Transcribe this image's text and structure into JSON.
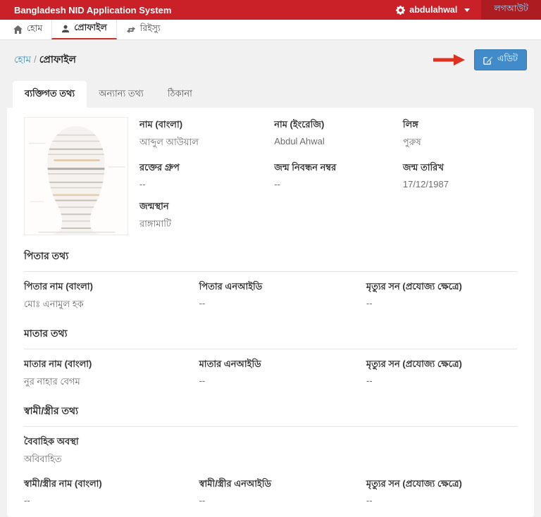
{
  "header": {
    "title": "Bangladesh NID Application System",
    "username": "abdulahwal",
    "logout_label": "লগআউট"
  },
  "nav": {
    "items": [
      {
        "label": "হোম",
        "icon": "home-icon",
        "active": false
      },
      {
        "label": "প্রোফাইল",
        "icon": "user-icon",
        "active": true
      },
      {
        "label": "রিইস্যু",
        "icon": "refresh-icon",
        "active": false
      }
    ]
  },
  "breadcrumb": {
    "home": "হোম",
    "separator": "/",
    "current": "প্রোফাইল"
  },
  "toolbar": {
    "edit_label": "এডিট"
  },
  "tabs": [
    {
      "label": "ব্যক্তিগত তথ্য",
      "active": true
    },
    {
      "label": "অন্যান্য তথ্য",
      "active": false
    },
    {
      "label": "ঠিকানা",
      "active": false
    }
  ],
  "personal": {
    "fields": [
      {
        "label": "নাম (বাংলা)",
        "value": "আব্দুল আউয়াল"
      },
      {
        "label": "নাম (ইংরেজি)",
        "value": "Abdul Ahwal"
      },
      {
        "label": "লিঙ্গ",
        "value": "পুরুষ"
      },
      {
        "label": "রক্তের গ্রুপ",
        "value": "--"
      },
      {
        "label": "জন্ম নিবন্ধন নম্বর",
        "value": "--"
      },
      {
        "label": "জন্ম তারিখ",
        "value": "17/12/1987"
      },
      {
        "label": "জন্মস্থান",
        "value": "রাঙ্গামাটি"
      }
    ]
  },
  "father": {
    "title": "পিতার তথ্য",
    "fields": [
      {
        "label": "পিতার নাম (বাংলা)",
        "value": "মোঃ এনামুল হক"
      },
      {
        "label": "পিতার এনআইডি",
        "value": "--"
      },
      {
        "label": "মৃত্যুর সন (প্রযোজ্য ক্ষেত্রে)",
        "value": "--"
      }
    ]
  },
  "mother": {
    "title": "মাতার তথ্য",
    "fields": [
      {
        "label": "মাতার নাম (বাংলা)",
        "value": "নুর নাহার বেগম"
      },
      {
        "label": "মাতার এনআইডি",
        "value": "--"
      },
      {
        "label": "মৃত্যুর সন (প্রযোজ্য ক্ষেত্রে)",
        "value": "--"
      }
    ]
  },
  "spouse": {
    "title": "স্বামী/স্ত্রীর তথ্য",
    "marital": {
      "label": "বৈবাহিক অবস্থা",
      "value": "অবিবাহিত"
    },
    "fields": [
      {
        "label": "স্বামী/স্ত্রীর নাম (বাংলা)",
        "value": "--"
      },
      {
        "label": "স্বামী/স্ত্রীর এনআইডি",
        "value": "--"
      },
      {
        "label": "মৃত্যুর সন (প্রযোজ্য ক্ষেত্রে)",
        "value": "--"
      }
    ]
  },
  "icons": {
    "gear": "gear-icon",
    "caret_down": "caret-down-icon",
    "home": "home-icon",
    "user": "user-icon",
    "refresh": "refresh-icon",
    "edit": "edit-pencil-icon",
    "annotation": "red-arrow-right"
  },
  "colors": {
    "header_red": "#c92127",
    "active_tab_underline": "#c9302c",
    "link_blue": "#3c8dbc",
    "edit_button_blue": "#428bca",
    "logout_link_blue": "#a5d2f3",
    "arrow_red": "#e0301e"
  }
}
